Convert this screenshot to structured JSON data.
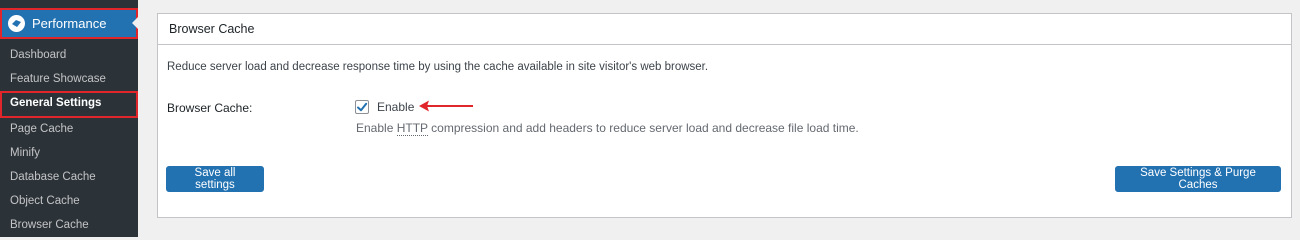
{
  "sidebar": {
    "menu_title": "Performance",
    "items": [
      {
        "label": "Dashboard"
      },
      {
        "label": "Feature Showcase"
      },
      {
        "label": "General Settings",
        "active": true
      },
      {
        "label": "Page Cache"
      },
      {
        "label": "Minify"
      },
      {
        "label": "Database Cache"
      },
      {
        "label": "Object Cache"
      },
      {
        "label": "Browser Cache"
      }
    ]
  },
  "panel": {
    "title": "Browser Cache",
    "description": "Reduce server load and decrease response time by using the cache available in site visitor's web browser.",
    "field_label": "Browser Cache:",
    "checkbox_label": "Enable",
    "checkbox_checked": true,
    "help_before": "Enable ",
    "help_abbr": "HTTP",
    "help_after": " compression and add headers to reduce server load and decrease file load time."
  },
  "buttons": {
    "save_all": "Save all settings",
    "save_purge": "Save Settings & Purge Caches"
  },
  "colors": {
    "accent": "#2271b1",
    "highlight_border": "#e0262b",
    "sidebar_bg": "#2c3338"
  }
}
